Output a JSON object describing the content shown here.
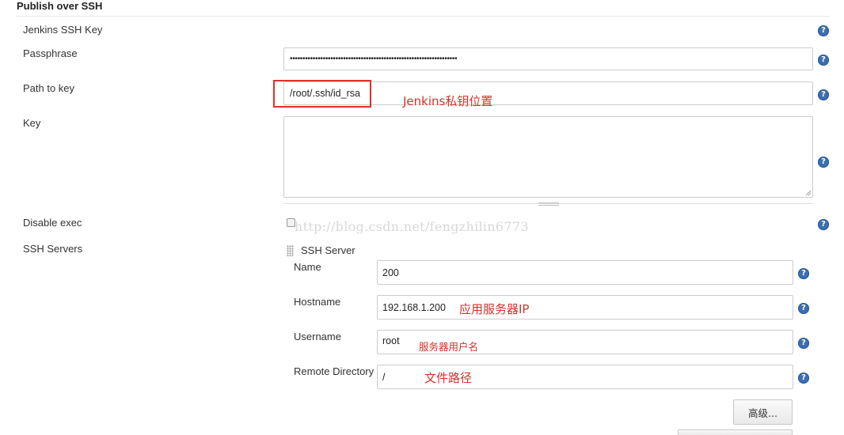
{
  "section": {
    "title": "Publish over SSH"
  },
  "fields": {
    "jenkins_ssh_key": {
      "label": "Jenkins SSH Key"
    },
    "passphrase": {
      "label": "Passphrase",
      "value": "••••••••••••••••••••••••••••••••••••••••••••••••••••••••••••••••••"
    },
    "path_to_key": {
      "label": "Path to key",
      "value": "/root/.ssh/id_rsa"
    },
    "key": {
      "label": "Key",
      "value": ""
    },
    "disable_exec": {
      "label": "Disable exec",
      "checked": false
    },
    "ssh_servers": {
      "label": "SSH Servers"
    }
  },
  "ssh_server": {
    "header": "SSH Server",
    "name": {
      "label": "Name",
      "value": "200"
    },
    "hostname": {
      "label": "Hostname",
      "value": "192.168.1.200"
    },
    "username": {
      "label": "Username",
      "value": "root"
    },
    "remote_directory": {
      "label": "Remote Directory",
      "value": "/"
    }
  },
  "buttons": {
    "advanced": "高级..."
  },
  "help_icon_glyph": "?",
  "annotations": {
    "path_to_key": "Jenkins私钥位置",
    "hostname": "应用服务器IP",
    "username": "服务器用户名",
    "remote_directory": "文件路径",
    "color": "#d3322b"
  },
  "watermark": "http://blog.csdn.net/fengzhilin6773",
  "colors": {
    "help_icon": "#3b6fb0",
    "highlight_border": "#e0302a",
    "field_border": "#cccccc"
  }
}
